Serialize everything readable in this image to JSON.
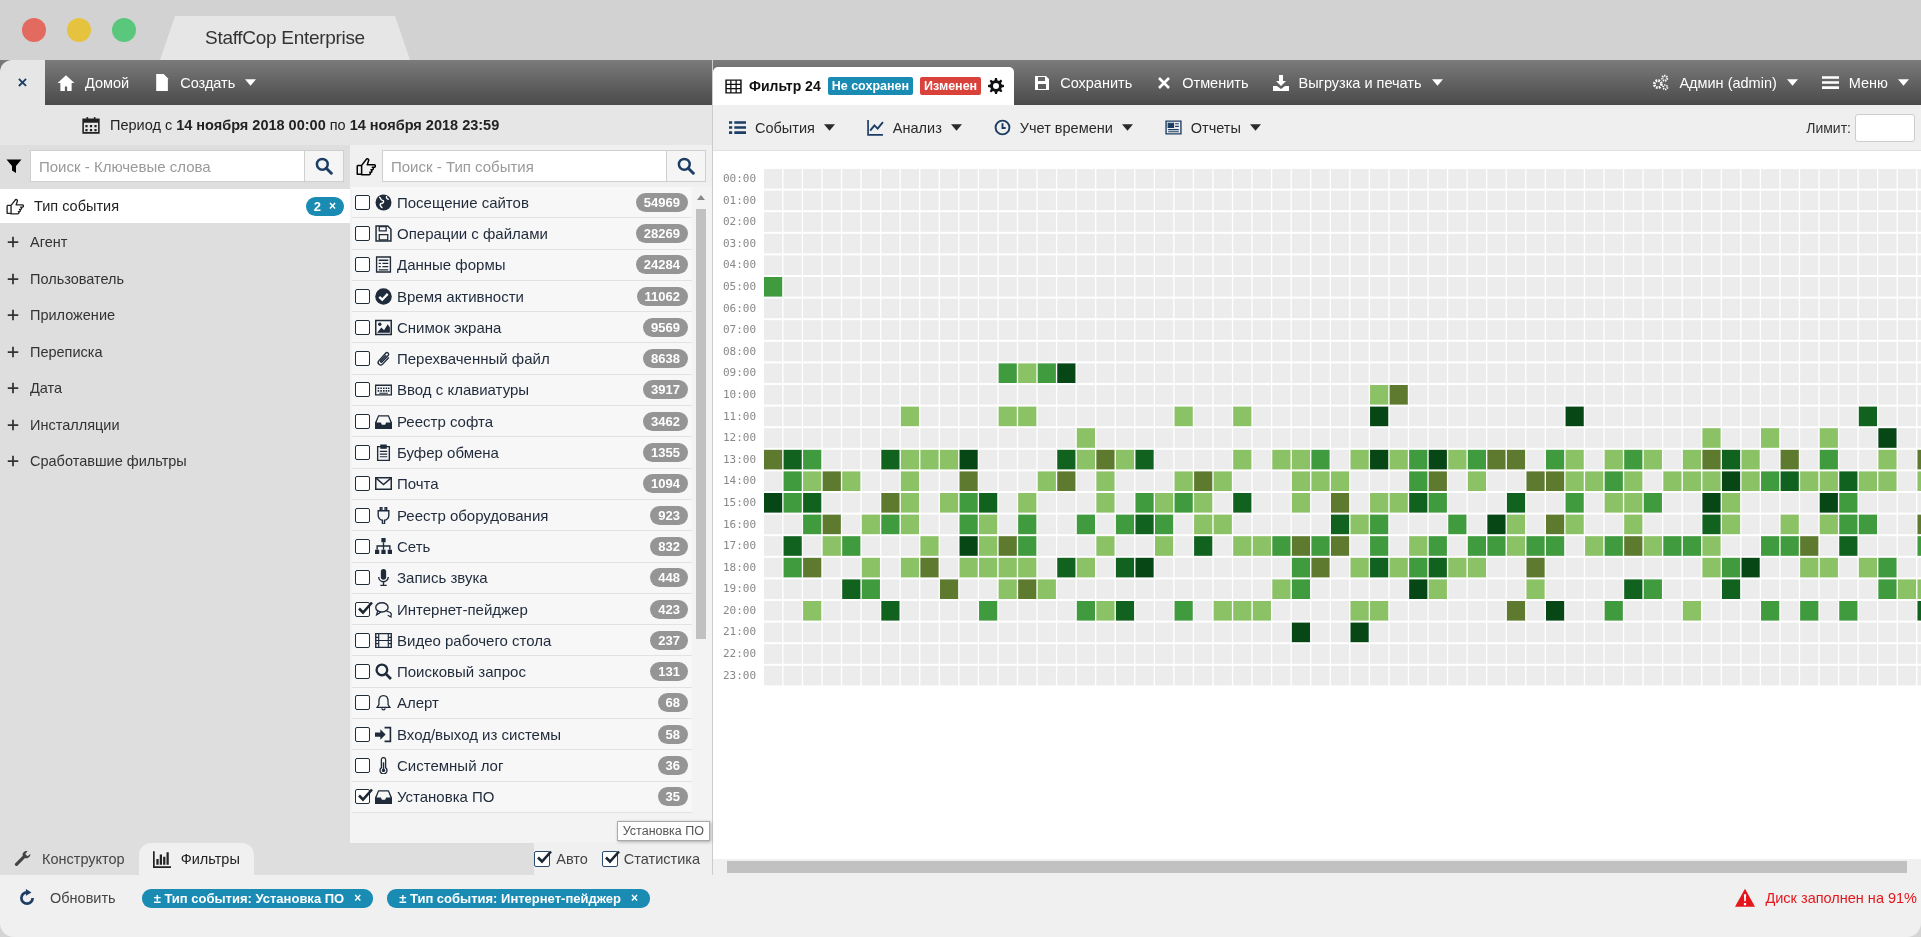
{
  "window": {
    "title": "StaffCop Enterprise"
  },
  "nav": {
    "close": "×",
    "items": [
      {
        "label": "Домой",
        "dropdown": false
      },
      {
        "label": "Создать",
        "dropdown": true
      }
    ]
  },
  "period": "Период с **14 ноября 2018 00:00** по **14 ноября 2018 23:59**",
  "keyword_search": {
    "placeholder": "Поиск - Ключевые слова"
  },
  "categories": [
    {
      "label": "Тип события",
      "selected": true,
      "badge": "2",
      "badge_remove": "×"
    },
    {
      "label": "Агент",
      "selected": false
    },
    {
      "label": "Пользователь",
      "selected": false
    },
    {
      "label": "Приложение",
      "selected": false
    },
    {
      "label": "Переписка",
      "selected": false
    },
    {
      "label": "Дата",
      "selected": false
    },
    {
      "label": "Инсталляции",
      "selected": false
    },
    {
      "label": "Сработавшие фильтры",
      "selected": false
    }
  ],
  "event_search": {
    "placeholder": "Поиск - Тип события"
  },
  "event_types": [
    {
      "label": "Посещение сайтов",
      "count": "54969",
      "checked": false
    },
    {
      "label": "Операции с файлами",
      "count": "28269",
      "checked": false
    },
    {
      "label": "Данные формы",
      "count": "24284",
      "checked": false
    },
    {
      "label": "Время активности",
      "count": "11062",
      "checked": false
    },
    {
      "label": "Снимок экрана",
      "count": "9569",
      "checked": false
    },
    {
      "label": "Перехваченный файл",
      "count": "8638",
      "checked": false
    },
    {
      "label": "Ввод с клавиатуры",
      "count": "3917",
      "checked": false
    },
    {
      "label": "Реестр софта",
      "count": "3462",
      "checked": false
    },
    {
      "label": "Буфер обмена",
      "count": "1355",
      "checked": false
    },
    {
      "label": "Почта",
      "count": "1094",
      "checked": false
    },
    {
      "label": "Реестр оборудования",
      "count": "923",
      "checked": false
    },
    {
      "label": "Сеть",
      "count": "832",
      "checked": false
    },
    {
      "label": "Запись звука",
      "count": "448",
      "checked": false
    },
    {
      "label": "Интернет-пейджер",
      "count": "423",
      "checked": true
    },
    {
      "label": "Видео рабочего стола",
      "count": "237",
      "checked": false
    },
    {
      "label": "Поисковый запрос",
      "count": "131",
      "checked": false
    },
    {
      "label": "Алерт",
      "count": "68",
      "checked": false
    },
    {
      "label": "Вход/выход из системы",
      "count": "58",
      "checked": false
    },
    {
      "label": "Системный лог",
      "count": "36",
      "checked": false
    },
    {
      "label": "Установка ПО",
      "count": "35",
      "checked": true
    }
  ],
  "tooltip": "Установка ПО",
  "bottom_tabs": [
    {
      "label": "Конструктор",
      "selected": false
    },
    {
      "label": "Фильтры",
      "selected": true
    }
  ],
  "options": [
    {
      "label": "Авто",
      "checked": true
    },
    {
      "label": "Статистика",
      "checked": true
    }
  ],
  "filter_tab": {
    "title": "Фильтр 24",
    "selected": true,
    "badges": [
      {
        "text": "Не сохранен",
        "color": "#1a8bb3"
      },
      {
        "text": "Изменен",
        "color": "#d9413b"
      }
    ]
  },
  "actions": [
    {
      "label": "Сохранить",
      "dropdown": false
    },
    {
      "label": "Отменить",
      "dropdown": false
    },
    {
      "label": "Выгрузка и печать",
      "dropdown": true
    }
  ],
  "user_menu": [
    {
      "label": "Админ (admin)",
      "dropdown": true
    },
    {
      "label": "Меню",
      "dropdown": true
    }
  ],
  "toolbar": [
    {
      "label": "События",
      "dropdown": true
    },
    {
      "label": "Анализ",
      "dropdown": true
    },
    {
      "label": "Учет времени",
      "dropdown": true
    },
    {
      "label": "Отчеты",
      "dropdown": true
    }
  ],
  "limit": {
    "label": "Лимит:"
  },
  "heatmap": {
    "hours": [
      "00:00",
      "01:00",
      "02:00",
      "03:00",
      "04:00",
      "05:00",
      "06:00",
      "07:00",
      "08:00",
      "09:00",
      "10:00",
      "11:00",
      "12:00",
      "13:00",
      "14:00",
      "15:00",
      "16:00",
      "17:00",
      "18:00",
      "19:00",
      "20:00",
      "21:00",
      "22:00",
      "23:00"
    ]
  },
  "refresh": "Обновить",
  "active_filters": [
    {
      "label": "± Тип события: Установка ПО",
      "remove": "×"
    },
    {
      "label": "± Тип события: Интернет-пейджер",
      "remove": "×"
    }
  ],
  "status": "Диск заполнен на 91%"
}
